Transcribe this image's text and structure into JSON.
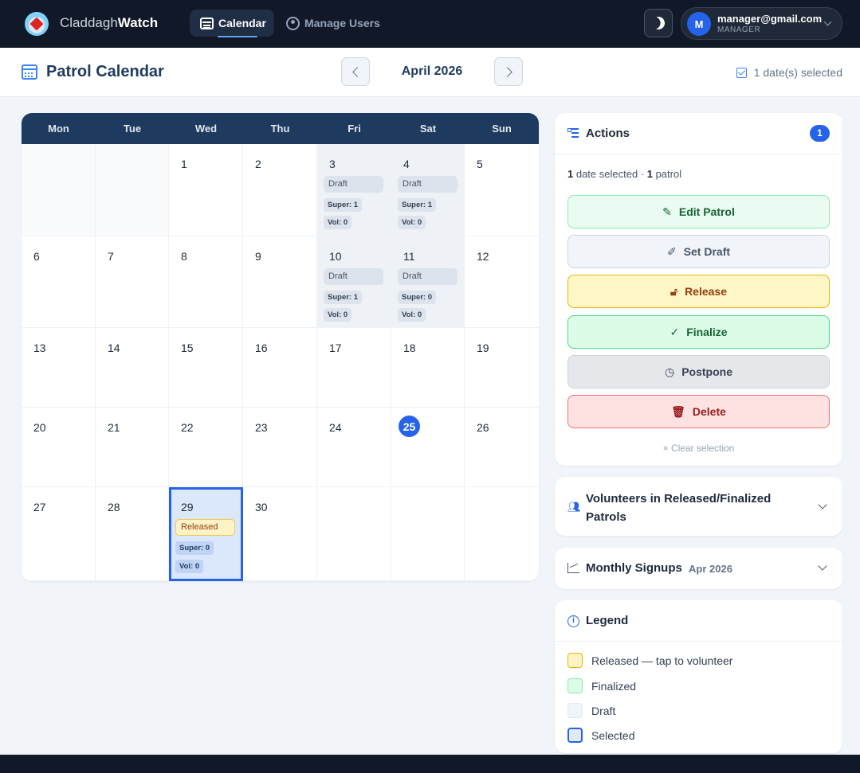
{
  "app": {
    "brand_light": "Claddagh",
    "brand_bold": "Watch"
  },
  "nav": {
    "calendar_label": "Calendar",
    "users_label": "Manage Users"
  },
  "user": {
    "avatar_letter": "M",
    "email": "manager@gmail.com",
    "role": "MANAGER"
  },
  "header": {
    "title": "Patrol Calendar",
    "month": "April 2026",
    "selected_text": "1 date(s) selected"
  },
  "calendar": {
    "weekdays": [
      "Mon",
      "Tue",
      "Wed",
      "Thu",
      "Fri",
      "Sat",
      "Sun"
    ],
    "today": 25,
    "cells": [
      {
        "day": ""
      },
      {
        "day": ""
      },
      {
        "day": "1"
      },
      {
        "day": "2"
      },
      {
        "day": "3",
        "status": "Draft",
        "super": "Super: 1",
        "vol": "Vol: 0"
      },
      {
        "day": "4",
        "status": "Draft",
        "super": "Super: 1",
        "vol": "Vol: 0"
      },
      {
        "day": "5"
      },
      {
        "day": "6"
      },
      {
        "day": "7"
      },
      {
        "day": "8"
      },
      {
        "day": "9"
      },
      {
        "day": "10",
        "status": "Draft",
        "super": "Super: 1",
        "vol": "Vol: 0"
      },
      {
        "day": "11",
        "status": "Draft",
        "super": "Super: 0",
        "vol": "Vol: 0"
      },
      {
        "day": "12"
      },
      {
        "day": "13"
      },
      {
        "day": "14"
      },
      {
        "day": "15"
      },
      {
        "day": "16"
      },
      {
        "day": "17"
      },
      {
        "day": "18"
      },
      {
        "day": "19"
      },
      {
        "day": "20"
      },
      {
        "day": "21"
      },
      {
        "day": "22"
      },
      {
        "day": "23"
      },
      {
        "day": "24"
      },
      {
        "day": "25"
      },
      {
        "day": "26"
      },
      {
        "day": "27"
      },
      {
        "day": "28"
      },
      {
        "day": "29",
        "status": "Released",
        "super": "Super: 0",
        "vol": "Vol: 0"
      },
      {
        "day": "30"
      },
      {
        "day": ""
      },
      {
        "day": ""
      },
      {
        "day": ""
      }
    ]
  },
  "actions": {
    "title": "Actions",
    "badge": "1",
    "summary_count_dates": "1",
    "summary_dates_text": " date selected · ",
    "summary_count_patrols": "1",
    "summary_patrols_text": " patrol",
    "edit_label": "Edit Patrol",
    "draft_label": "Set Draft",
    "release_label": "Release",
    "finalize_label": "Finalize",
    "postpone_label": "Postpone",
    "delete_label": "Delete",
    "clear_label": "× Clear selection"
  },
  "volunteers": {
    "title": "Volunteers in Released/Finalized Patrols"
  },
  "monthly": {
    "title": "Monthly Signups",
    "subtitle": "Apr 2026"
  },
  "legend": {
    "title": "Legend",
    "items": [
      {
        "label": "Released — tap to volunteer",
        "color": "#fef3c7"
      },
      {
        "label": "Finalized",
        "color": "#dcfce7"
      },
      {
        "label": "Draft",
        "color": "#f1f5f9"
      },
      {
        "label": "Selected",
        "color": "#2563eb"
      }
    ]
  },
  "colors": {
    "accent": "#2563eb",
    "nav_bg": "#111827",
    "header_bg": "#1e3a5f"
  }
}
